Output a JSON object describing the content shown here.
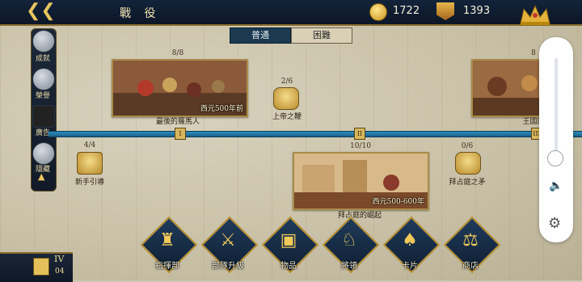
{
  "header": {
    "title": "戰 役",
    "gold": "1722",
    "medals": "1393"
  },
  "difficulty": {
    "normal": "普通",
    "hard": "困難"
  },
  "sidebar": [
    {
      "label": "成就",
      "icon": "trophy-icon"
    },
    {
      "label": "榮譽",
      "icon": "sword-icon"
    },
    {
      "label": "廣告",
      "icon": "film-icon"
    },
    {
      "label": "隱藏",
      "icon": "gauntlet-icon"
    }
  ],
  "timeline": {
    "markers": [
      "I",
      "II",
      "III"
    ]
  },
  "campaigns": [
    {
      "name": "最後的羅馬人",
      "progress": "8/8",
      "era": "西元500年前"
    },
    {
      "name": "上帝之鞭",
      "progress": "2/6"
    },
    {
      "name": "新手引導",
      "progress": "4/4"
    },
    {
      "name": "拜占庭的崛起",
      "progress": "10/10",
      "era": "西元500-600年"
    },
    {
      "name": "拜占庭之矛",
      "progress": "0/6"
    },
    {
      "name": "王國的",
      "progress": "8"
    }
  ],
  "bottom_menu": [
    {
      "label": "指揮部",
      "icon": "castle-icon"
    },
    {
      "label": "部隊升級",
      "icon": "crossed-swords-icon"
    },
    {
      "label": "物品",
      "icon": "chest-icon"
    },
    {
      "label": "將領",
      "icon": "helmet-icon"
    },
    {
      "label": "卡片",
      "icon": "cards-icon"
    },
    {
      "label": "商店",
      "icon": "scales-icon"
    }
  ],
  "corner": {
    "level": "IV",
    "sub": "04"
  }
}
